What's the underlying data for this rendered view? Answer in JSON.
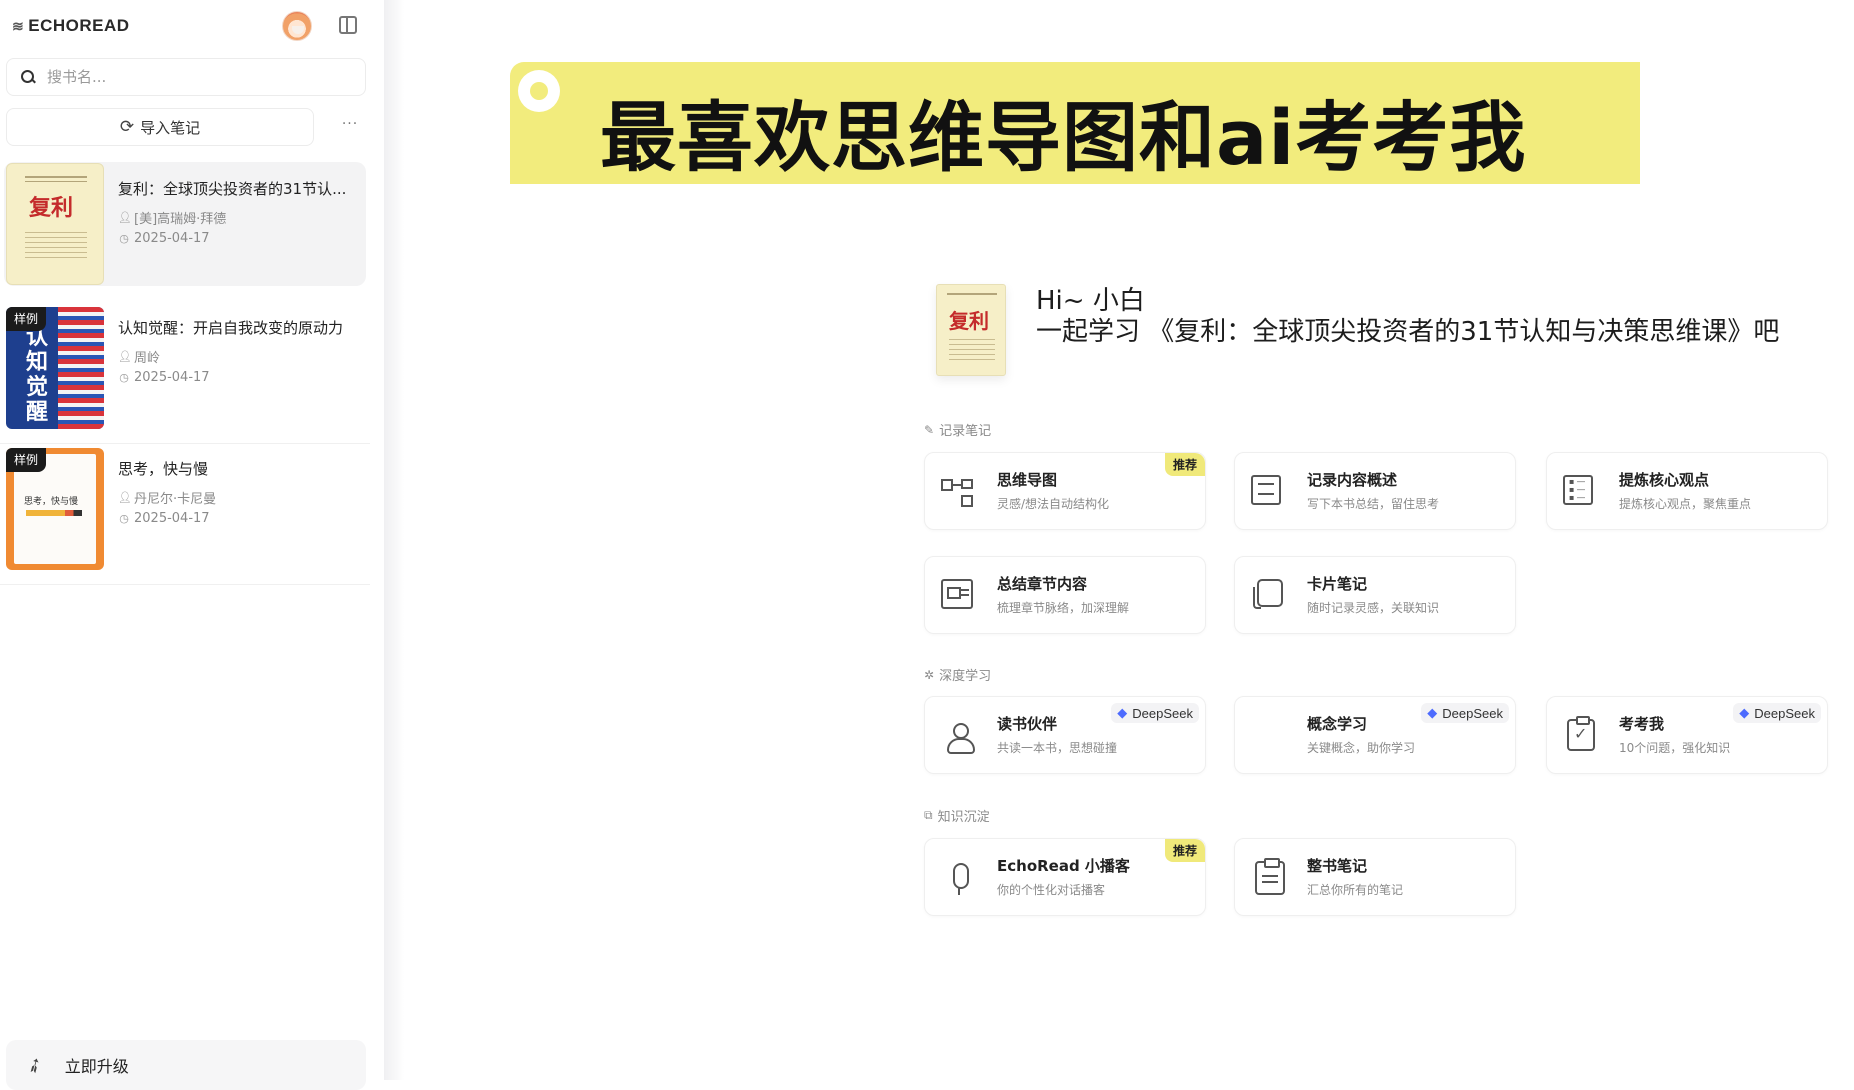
{
  "app": {
    "logo_text": "ECHOREAD"
  },
  "search": {
    "placeholder": "搜书名..."
  },
  "sidebar": {
    "import_label": "导入笔记",
    "more_label": "···",
    "sample_badge": "样例",
    "books": [
      {
        "title": "复利：全球顶尖投资者的31节认...",
        "author": "[美]高瑞姆·拜德",
        "date": "2025-04-17",
        "cover_text": "复利",
        "sample": false
      },
      {
        "title": "认知觉醒：开启自我改变的原动力",
        "author": "周岭",
        "date": "2025-04-17",
        "cover_text": "认知觉醒",
        "sample": true
      },
      {
        "title": "思考，快与慢",
        "author": "丹尼尔·卡尼曼",
        "date": "2025-04-17",
        "cover_text": "思考，快与慢",
        "sample": true
      }
    ],
    "upgrade_label": "立即升级"
  },
  "banner": {
    "text": "最喜欢思维导图和ai考考我"
  },
  "greeting": {
    "cover_text": "复利",
    "hi": "Hi~ 小白",
    "line": "一起学习 《复利：全球顶尖投资者的31节认知与决策思维课》吧"
  },
  "sections": {
    "notes": "记录笔记",
    "deep": "深度学习",
    "knowledge": "知识沉淀"
  },
  "tags": {
    "recommend": "推荐",
    "deepseek": "DeepSeek"
  },
  "cards": {
    "mindmap": {
      "title": "思维导图",
      "sub": "灵感/想法自动结构化"
    },
    "summary_content": {
      "title": "记录内容概述",
      "sub": "写下本书总结，留住思考"
    },
    "core_points": {
      "title": "提炼核心观点",
      "sub": "提炼核心观点，聚焦重点"
    },
    "chapter_summary": {
      "title": "总结章节内容",
      "sub": "梳理章节脉络，加深理解"
    },
    "card_note": {
      "title": "卡片笔记",
      "sub": "随时记录灵感，关联知识"
    },
    "reading_partner": {
      "title": "读书伙伴",
      "sub": "共读一本书，思想碰撞"
    },
    "concept_learning": {
      "title": "概念学习",
      "sub": "关键概念，助你学习"
    },
    "quiz_me": {
      "title": "考考我",
      "sub": "10个问题，强化知识"
    },
    "podcast": {
      "title": "EchoRead 小播客",
      "sub": "你的个性化对话播客"
    },
    "book_notes": {
      "title": "整书笔记",
      "sub": "汇总你所有的笔记"
    }
  }
}
